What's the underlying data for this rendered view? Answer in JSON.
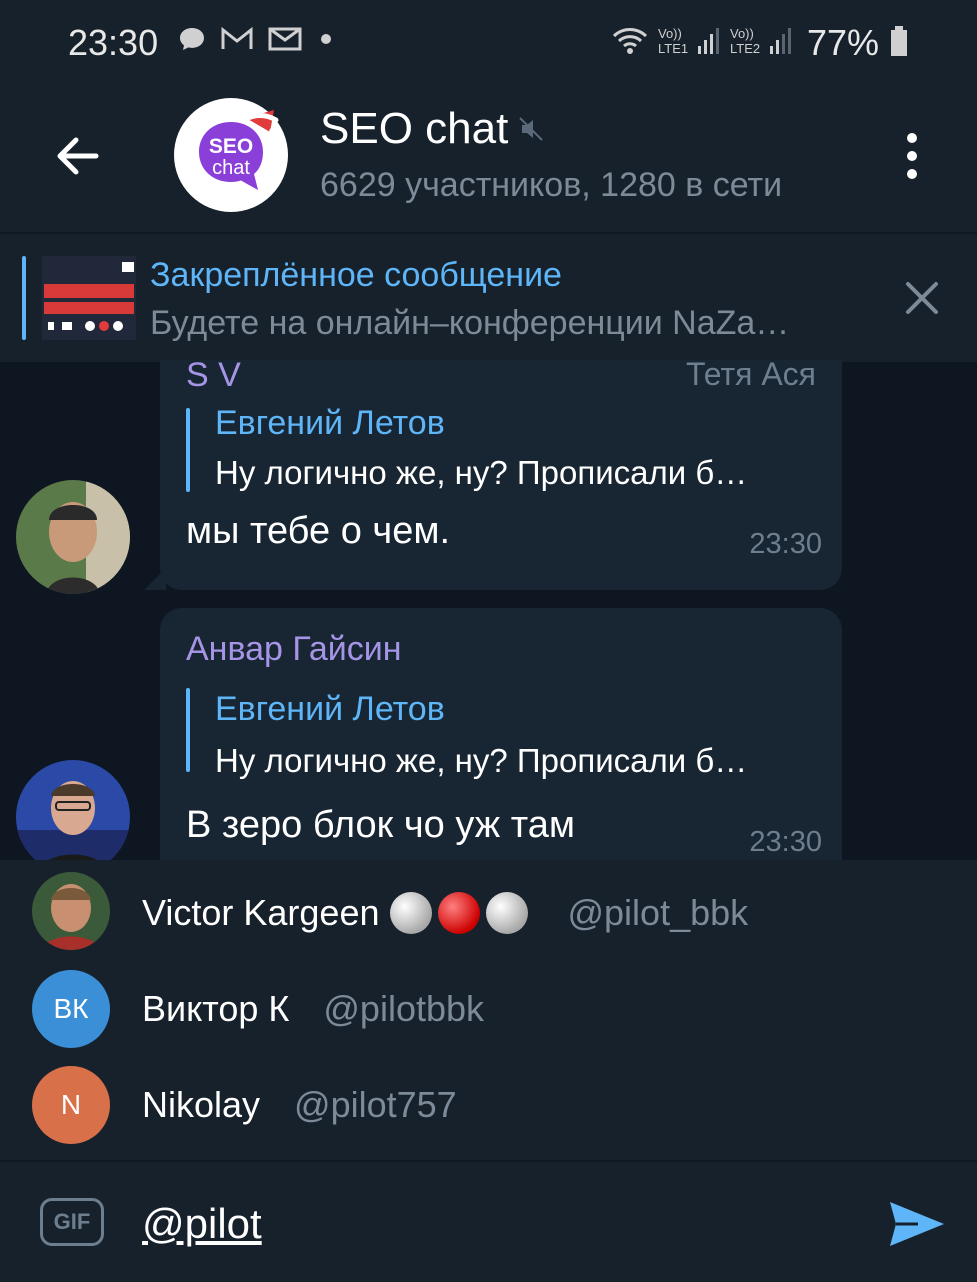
{
  "status_bar": {
    "time": "23:30",
    "battery": "77%",
    "icons": [
      "chat-bubble-icon",
      "gmail-icon",
      "mail-icon",
      "dot-icon",
      "wifi-icon",
      "lte1-signal-icon",
      "lte2-signal-icon",
      "battery-icon"
    ]
  },
  "header": {
    "title": "SEO chat",
    "subtitle": "6629 участников, 1280 в сети",
    "avatar_text_1": "SEO",
    "avatar_text_2": "chat",
    "muted": true
  },
  "pinned": {
    "title": "Закреплённое сообщение",
    "text": "Будете на онлайн–конференции NaZa…"
  },
  "messages": [
    {
      "sender": "S V",
      "sender_extra": "Тетя Ася",
      "reply_name": "Евгений Летов",
      "reply_text": "Ну логично же, ну? Прописали б…",
      "text": "мы тебе о чем.",
      "time": "23:30"
    },
    {
      "sender": "Анвар Гайсин",
      "reply_name": "Евгений Летов",
      "reply_text": "Ну логично же, ну? Прописали б…",
      "text": "В зеро блок чо уж там",
      "time": "23:30"
    }
  ],
  "mentions": [
    {
      "name": "Victor Kargeen",
      "username": "@pilot_bbk",
      "initials": "",
      "color": "#6b4a3a"
    },
    {
      "name": "Виктор К",
      "username": "@pilotbbk",
      "initials": "ВК",
      "color": "#3b8fd6"
    },
    {
      "name": "Nikolay",
      "username": "@pilot757",
      "initials": "N",
      "color": "#d8704a"
    }
  ],
  "input": {
    "gif_label": "GIF",
    "value": "@pilot"
  },
  "colors": {
    "background": "#0e1621",
    "panel": "#17212b",
    "bubble": "#182533",
    "accent": "#5eb5f7",
    "sender": "#a695e7"
  }
}
